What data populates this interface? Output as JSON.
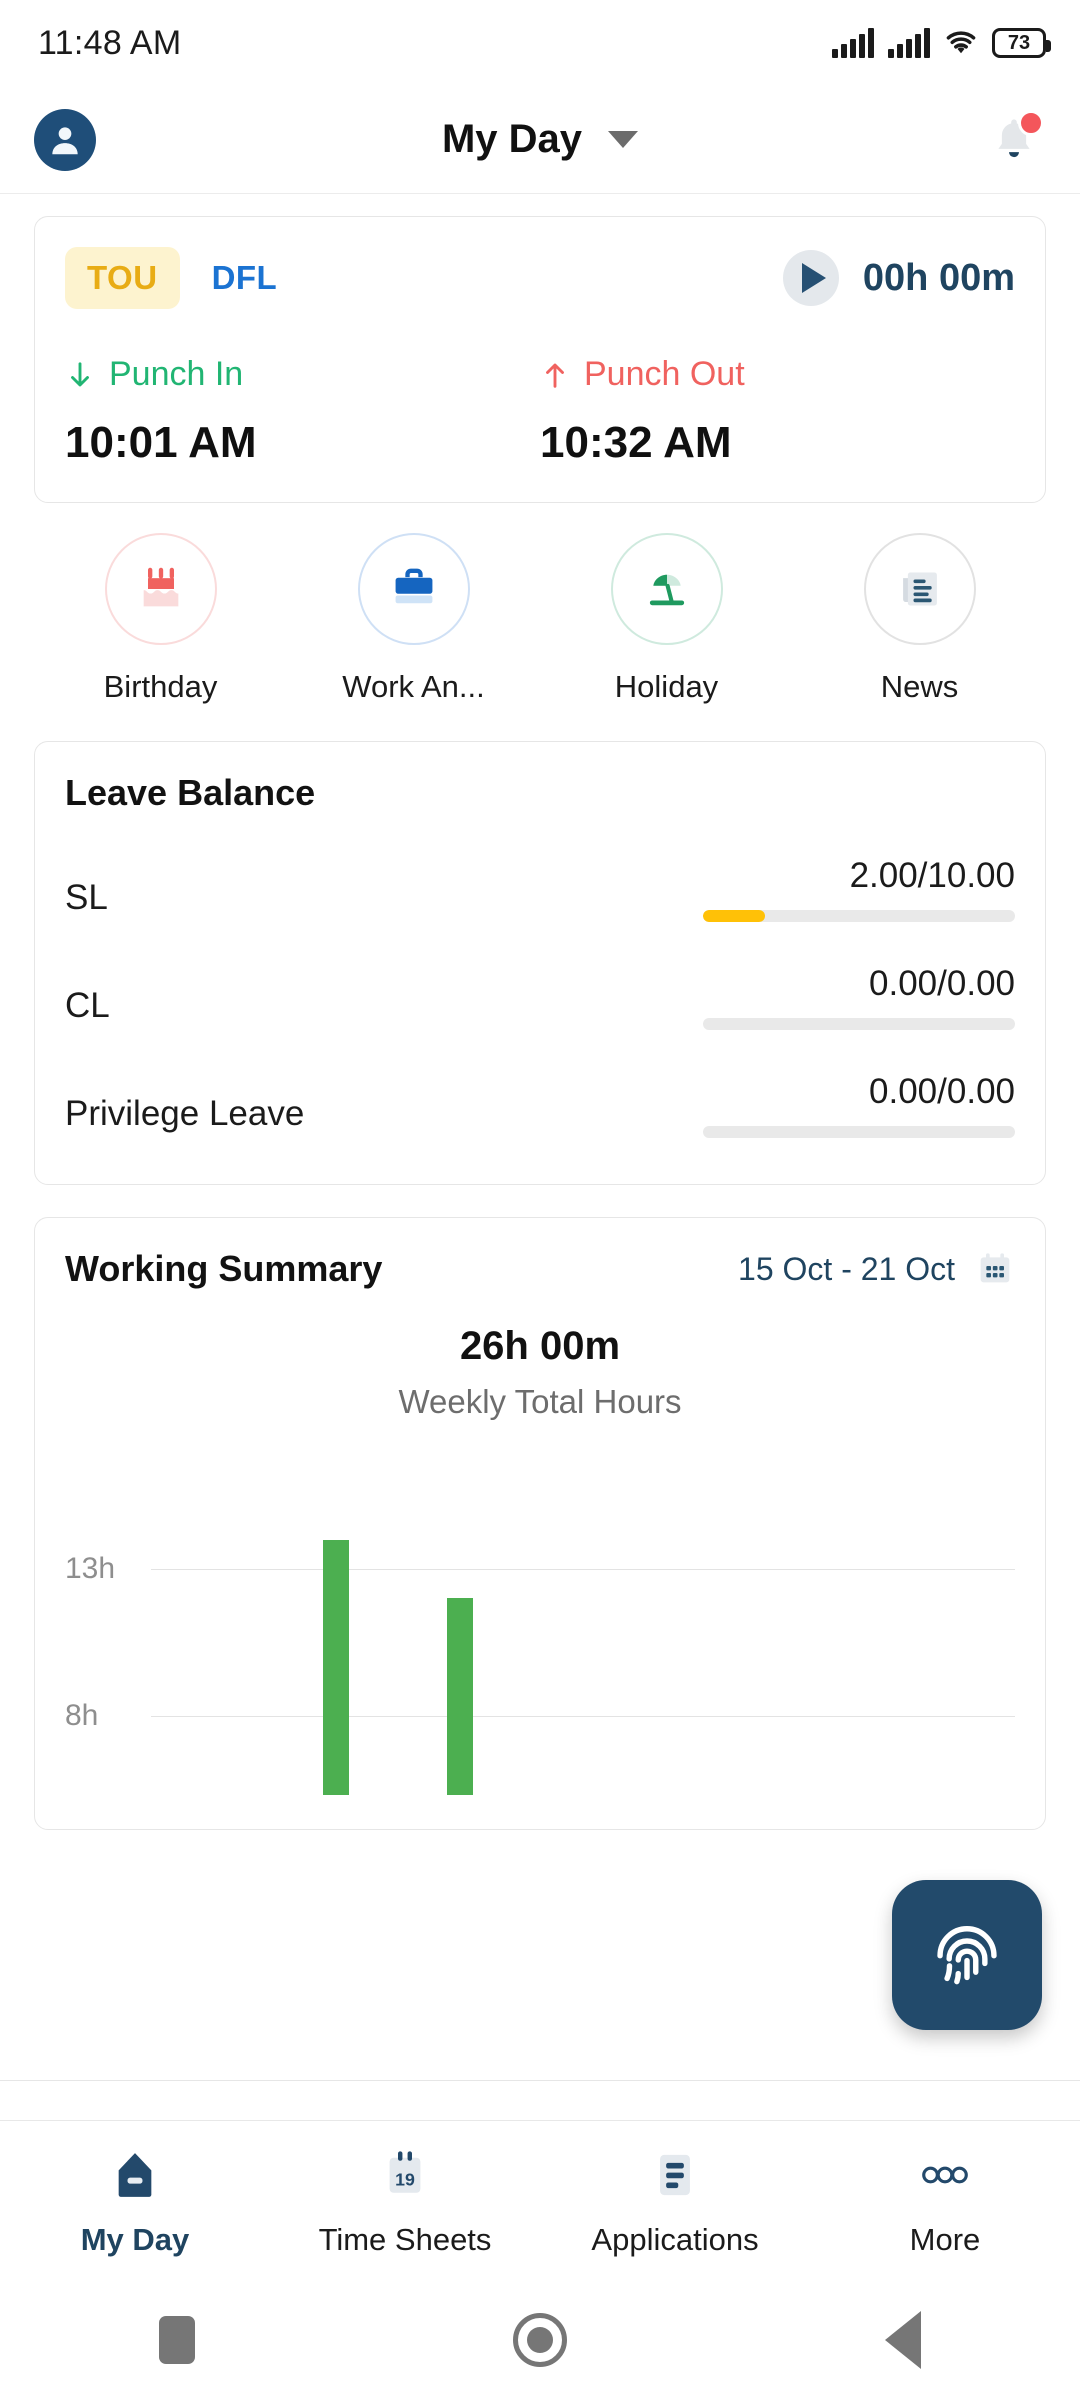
{
  "status_bar": {
    "time": "11:48 AM",
    "battery_level": "73",
    "icons": [
      "signal-bars-sim1",
      "signal-bars-sim2",
      "wifi-icon",
      "battery-icon"
    ]
  },
  "header": {
    "avatar": "user-avatar-icon",
    "title": "My Day",
    "dropdown_icon": "chevron-down-icon",
    "notification_icon": "bell-icon",
    "notification_badge": true
  },
  "punch_card": {
    "shift_chip": "TOU",
    "shift_secondary": "DFL",
    "play_icon": "play-icon",
    "worked_duration": "00h 00m",
    "punch_in_label": "Punch In",
    "punch_in_icon": "arrow-down-icon",
    "punch_in_time": "10:01 AM",
    "punch_out_label": "Punch Out",
    "punch_out_icon": "arrow-up-icon",
    "punch_out_time": "10:32 AM"
  },
  "quick_actions": [
    {
      "label": "Birthday",
      "icon": "birthday-cake-icon"
    },
    {
      "label": "Work An...",
      "icon": "briefcase-icon"
    },
    {
      "label": "Holiday",
      "icon": "beach-umbrella-icon"
    },
    {
      "label": "News",
      "icon": "news-document-icon"
    }
  ],
  "leave_balance": {
    "title": "Leave Balance",
    "rows": [
      {
        "name": "SL",
        "value": "2.00/10.00",
        "percent": 20
      },
      {
        "name": "CL",
        "value": "0.00/0.00",
        "percent": 0
      },
      {
        "name": "Privilege Leave",
        "value": "0.00/0.00",
        "percent": 0
      }
    ]
  },
  "working_summary": {
    "title": "Working Summary",
    "date_range": "15 Oct - 21 Oct",
    "calendar_icon": "calendar-icon",
    "total_hours": "26h 00m",
    "subtitle": "Weekly Total Hours"
  },
  "chart_data": {
    "type": "bar",
    "title": "Weekly Total Hours",
    "categories": [
      "",
      "",
      "",
      "",
      "",
      "",
      ""
    ],
    "values": [
      0,
      14,
      12,
      0,
      0,
      0,
      0
    ],
    "ylabel": "",
    "xlabel": "",
    "ytick_labels": [
      "13h",
      "8h"
    ],
    "ytick_values": [
      13,
      8
    ],
    "ylim": [
      0,
      16
    ],
    "grid": true,
    "series_color": "#4caf50",
    "legend": "none"
  },
  "fab": {
    "icon": "fingerprint-icon",
    "color": "#224a6b"
  },
  "bottom_nav": {
    "active": "My Day",
    "items": [
      {
        "label": "My Day",
        "icon": "home-icon"
      },
      {
        "label": "Time Sheets",
        "icon": "calendar-19-icon"
      },
      {
        "label": "Applications",
        "icon": "list-icon"
      },
      {
        "label": "More",
        "icon": "more-dots-icon"
      }
    ]
  },
  "system_nav": {
    "recents": "square-icon",
    "home": "circle-icon",
    "back": "triangle-back-icon"
  }
}
